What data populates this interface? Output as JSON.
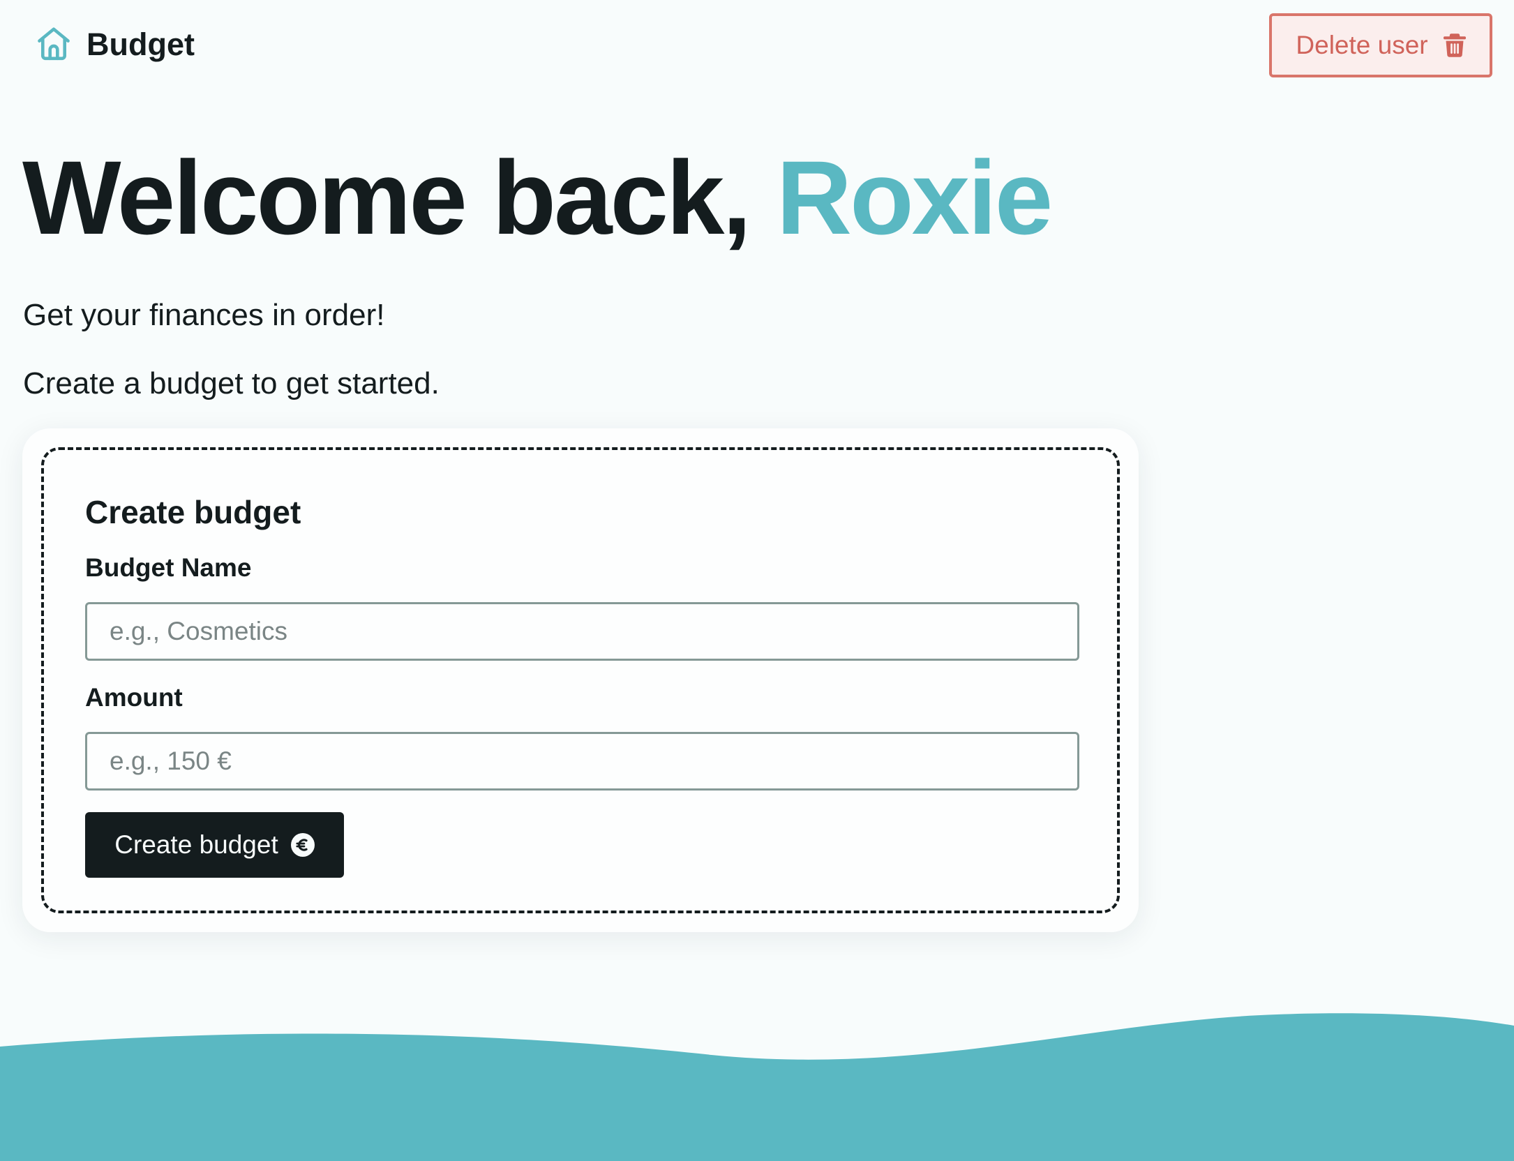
{
  "colors": {
    "accent": "#5ab8c2",
    "ink": "#141c1e",
    "background": "#f8fcfc",
    "danger": "#d0635a",
    "danger_background": "#fbeeed"
  },
  "nav": {
    "brand_icon": "home-icon",
    "brand_name": "Budget",
    "delete_user": {
      "label": "Delete user",
      "icon": "trash-icon"
    }
  },
  "hero": {
    "greeting": "Welcome back,",
    "user_name": "Roxie",
    "line_1": "Get your finances in order!",
    "line_2": "Create a budget to get started."
  },
  "create_budget_form": {
    "title": "Create budget",
    "name_label": "Budget Name",
    "name_value": "",
    "name_placeholder": "e.g., Cosmetics",
    "amount_label": "Amount",
    "amount_value": "",
    "amount_placeholder": "e.g., 150 €",
    "submit_label": "Create budget",
    "submit_icon": "euro-icon"
  },
  "footer": {
    "decoration": "wave"
  }
}
